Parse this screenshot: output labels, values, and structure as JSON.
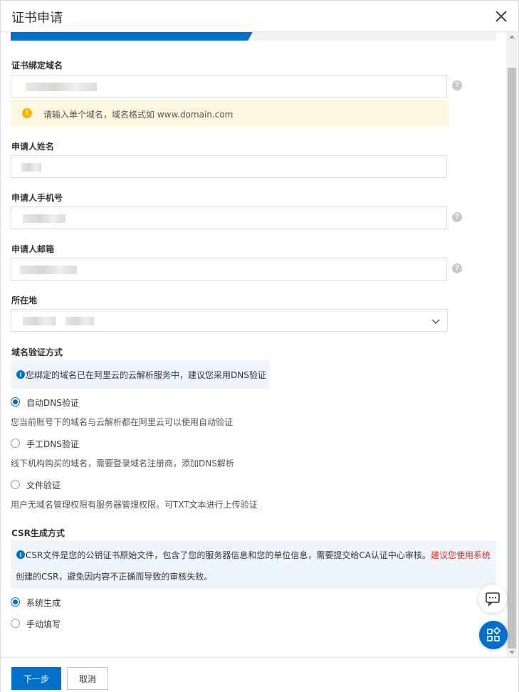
{
  "dialog": {
    "title": "证书申请"
  },
  "form": {
    "domain": {
      "label": "证书绑定域名",
      "warning": "请输入单个域名，域名格式如 www.domain.com"
    },
    "name": {
      "label": "申请人姓名"
    },
    "phone": {
      "label": "申请人手机号"
    },
    "email": {
      "label": "申请人邮箱"
    },
    "location": {
      "label": "所在地"
    },
    "verification": {
      "label": "域名验证方式",
      "info": "您绑定的域名已在阿里云的云解析服务中，建议您采用DNS验证",
      "options": [
        {
          "label": "自动DNS验证",
          "desc": "您当前账号下的域名与云解析都在阿里云可以使用自动验证",
          "selected": true
        },
        {
          "label": "手工DNS验证",
          "desc": "线下机构购买的域名，需要登录域名注册商，添加DNS解析",
          "selected": false
        },
        {
          "label": "文件验证",
          "desc": "用户无域名管理权限有服务器管理权限。可TXT文本进行上传验证",
          "selected": false
        }
      ]
    },
    "csr": {
      "label": "CSR生成方式",
      "info_line1": "CSR文件是您的公钥证书原始文件，包含了您的服务器信息和您的单位信息，需要提交给CA认证中心审核。",
      "info_line1_red": "建议您使用系统",
      "info_line2_red": "创建的CSR，避免因内容不正确而导致的审核失败。",
      "options": [
        {
          "label": "系统生成",
          "selected": true
        },
        {
          "label": "手动填写",
          "selected": false
        }
      ]
    }
  },
  "footer": {
    "next_label": "下一步",
    "cancel_label": "取消"
  },
  "colors": {
    "primary": "#0070cc",
    "warning_bg": "#fdf6e1",
    "info_bg": "#eef5fc",
    "error_text": "#d93026"
  },
  "icons": {
    "close": "close-icon",
    "help": "question-circle-icon",
    "warning": "warning-icon",
    "info": "info-icon",
    "chevron": "chevron-down-icon",
    "chat": "chat-icon",
    "apps": "apps-icon"
  }
}
